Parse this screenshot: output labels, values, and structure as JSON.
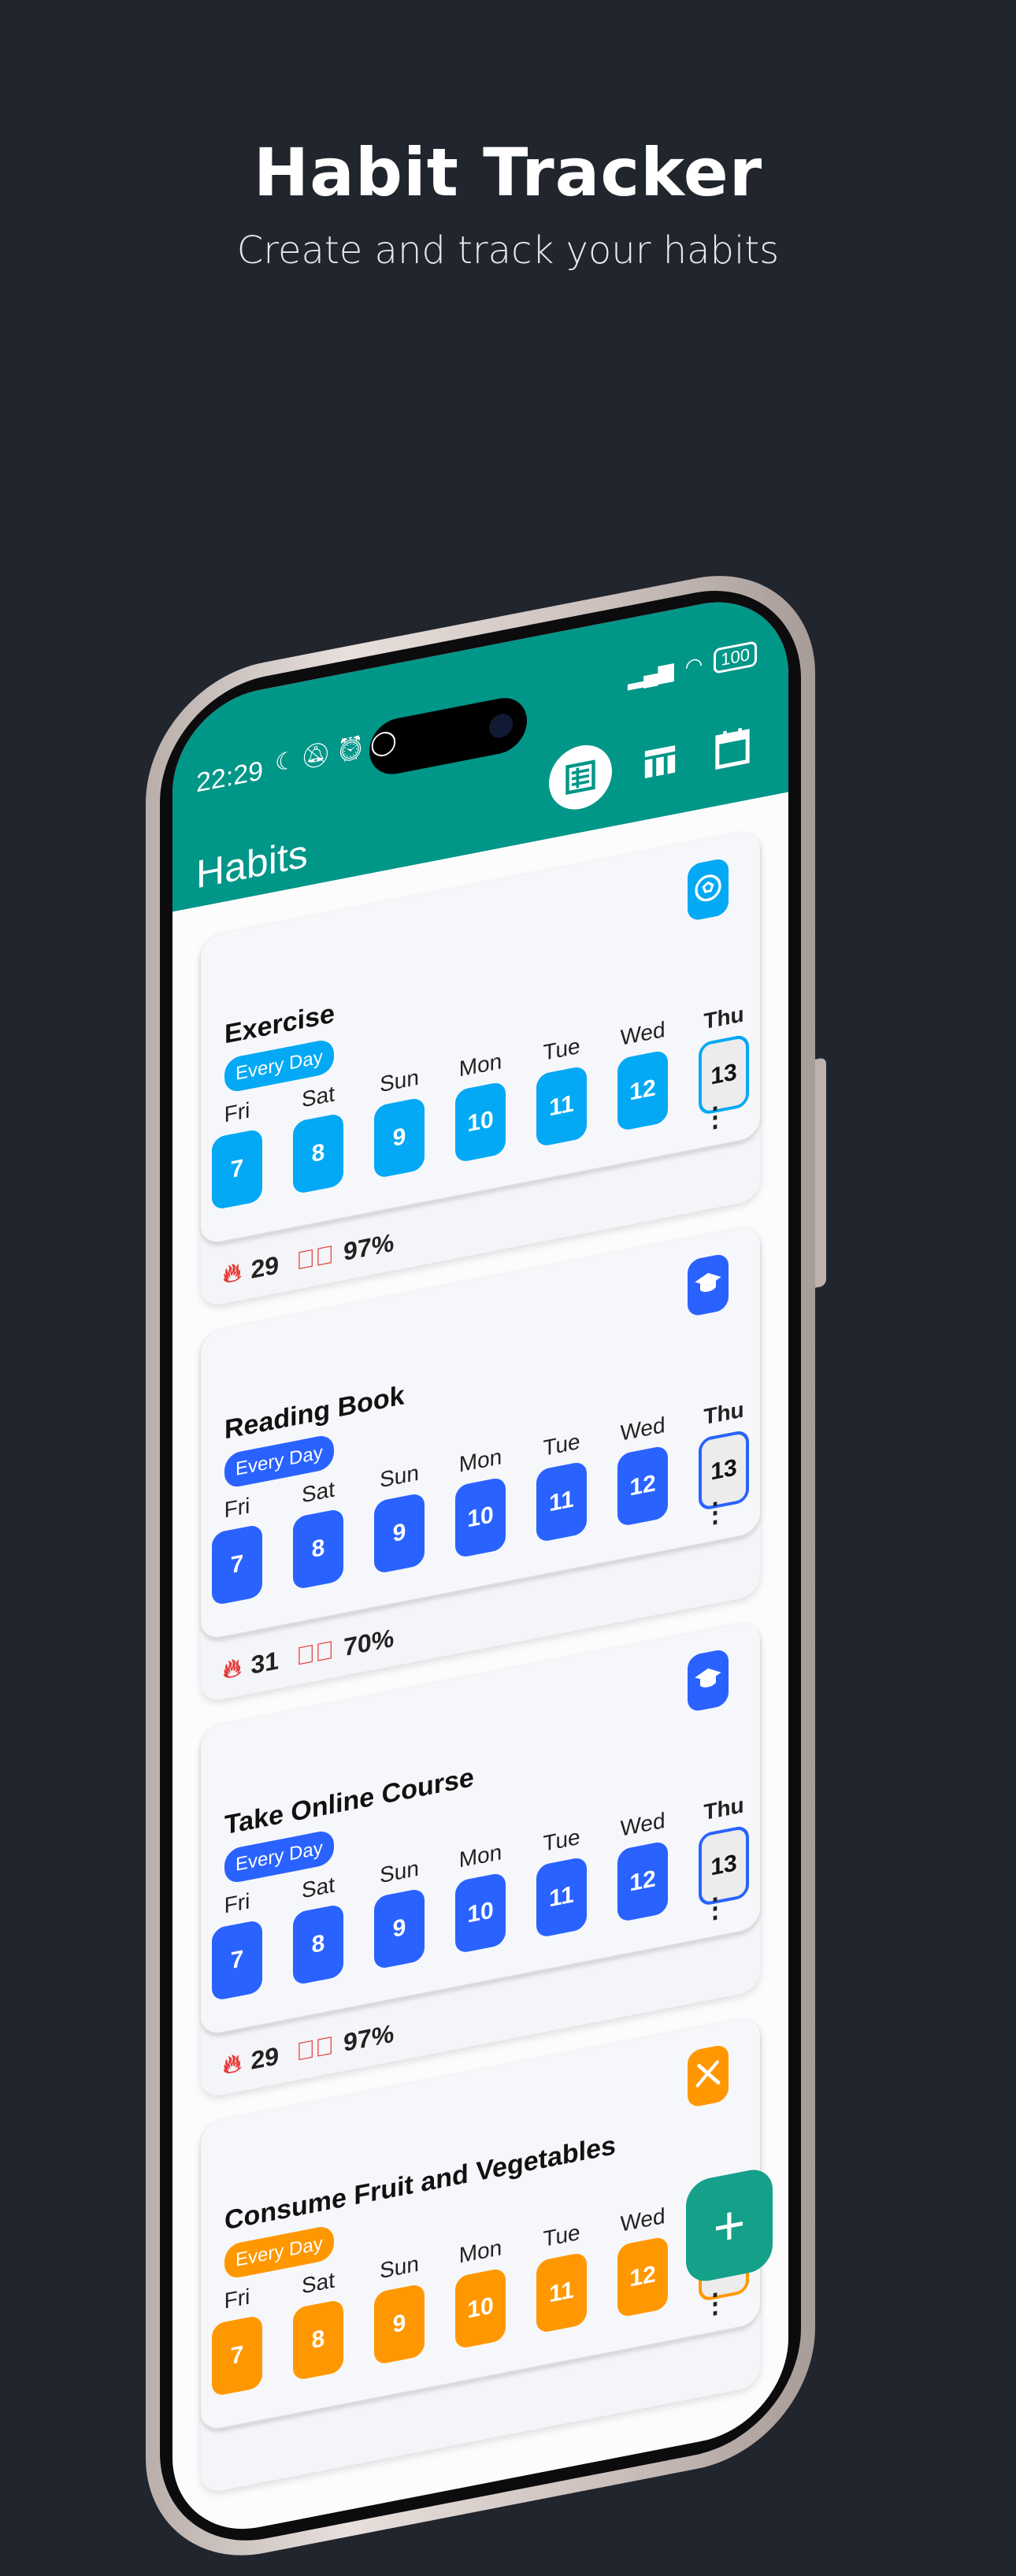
{
  "hero": {
    "title": "Habit Tracker",
    "subtitle": "Create and track your habits"
  },
  "status_bar": {
    "time": "22:29",
    "icons": [
      "moon-icon",
      "bell-off-icon",
      "alarm-icon",
      "whatsapp-icon"
    ],
    "battery": "100"
  },
  "app_bar": {
    "title": "Habits",
    "views": [
      "list-view-icon",
      "grid-view-icon",
      "calendar-view-icon"
    ],
    "active_view": "list-view-icon",
    "color": "#009688"
  },
  "day_labels": [
    "Fri",
    "Sat",
    "Sun",
    "Mon",
    "Tue",
    "Wed",
    "Thu"
  ],
  "day_numbers": [
    "7",
    "8",
    "9",
    "10",
    "11",
    "12",
    "13"
  ],
  "habits": [
    {
      "name": "Exercise",
      "frequency": "Every Day",
      "icon": "football-icon",
      "color": "#03a9f4",
      "streak": "29",
      "completion": "97%"
    },
    {
      "name": "Reading Book",
      "frequency": "Every Day",
      "icon": "graduation-cap-icon",
      "color": "#2962ff",
      "streak": "31",
      "completion": "70%"
    },
    {
      "name": "Take Online Course",
      "frequency": "Every Day",
      "icon": "graduation-cap-icon",
      "color": "#2962ff",
      "streak": "29",
      "completion": "97%"
    },
    {
      "name": "Consume Fruit and Vegetables",
      "frequency": "Every Day",
      "icon": "fork-knife-icon",
      "color": "#ff9800",
      "streak": "",
      "completion": ""
    }
  ],
  "fab": {
    "label": "+"
  }
}
